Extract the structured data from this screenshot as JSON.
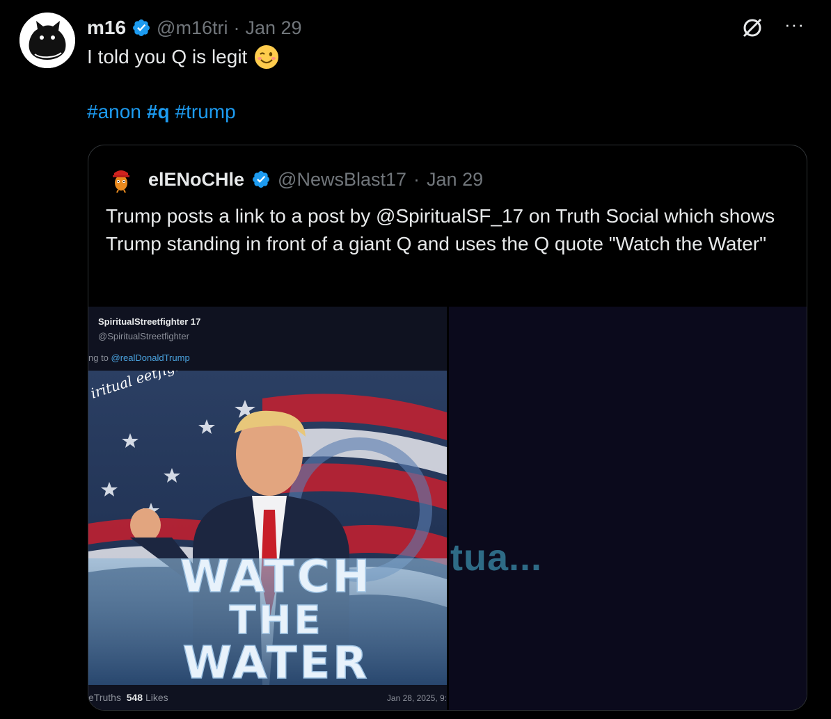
{
  "post": {
    "display_name": "m16",
    "handle": "@m16tri",
    "separator": "·",
    "date": "Jan 29",
    "text": "I told you Q is legit",
    "hashtags": [
      {
        "text": "#anon",
        "bold": false
      },
      {
        "text": "#q",
        "bold": true
      },
      {
        "text": "#trump",
        "bold": false
      }
    ],
    "more_label": "···"
  },
  "quote": {
    "display_name": "elENoCHle",
    "handle": "@NewsBlast17",
    "separator": "·",
    "date": "Jan 29",
    "text": "Trump posts a link to a post by @SpiritualSF_17 on Truth Social which shows Trump standing in front of a giant Q and uses the Q quote \"Watch the Water\""
  },
  "media": {
    "truth_name": "SpiritualStreetfighter 17",
    "truth_handle": "@SpiritualStreetfighter",
    "reply_prefix": "ng to ",
    "reply_mention": "@realDonaldTrump",
    "image_watermark": "iritual eetfighter",
    "image_caption_lines": [
      "WATCH",
      "THE",
      "WATER"
    ],
    "footer_left_prefix": "eTruths",
    "likes_count": "548",
    "likes_label": "Likes",
    "footer_right": "Jan 28, 2025, 9:",
    "right_pane_text": "tua..."
  },
  "colors": {
    "background": "#000000",
    "text": "#e7e9ea",
    "muted": "#71767b",
    "link": "#1d9bf0",
    "verified": "#1d9bf0",
    "border": "#2f3336"
  },
  "icons": {
    "verified": "verified-badge-icon",
    "grok": "grok-icon",
    "more": "more-icon",
    "wink": "winking-face-emoji"
  }
}
